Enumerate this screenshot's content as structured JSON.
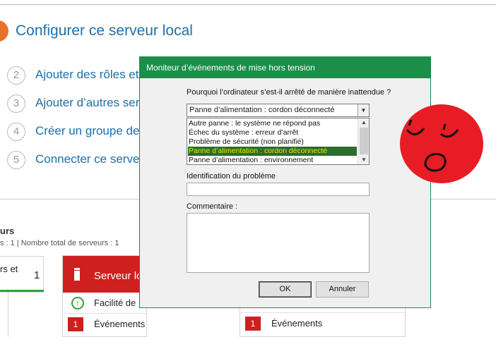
{
  "background_window": {
    "title": "Configurer ce serveur local",
    "steps": [
      {
        "num": "2",
        "label": "Ajouter des rôles et"
      },
      {
        "num": "3",
        "label": "Ajouter d’autres ser"
      },
      {
        "num": "4",
        "label": "Créer un groupe de"
      },
      {
        "num": "5",
        "label": "Connecter ce serveu"
      }
    ],
    "lower_title": "urs",
    "lower_stats": "s : 1   |   Nombre total de serveurs : 1",
    "left_tile": {
      "name": "rs et",
      "count": "1"
    },
    "server_tile": {
      "title": "Serveur lo",
      "rows": [
        {
          "label": "Facilité de"
        },
        {
          "badge": "1",
          "label": "Événements"
        }
      ]
    },
    "right_tile": {
      "badge": "1",
      "label": "Événements"
    }
  },
  "dialog": {
    "title": "Moniteur d’événements de mise hors tension",
    "question": "Pourquoi l’ordinateur s’est-il arrêté de manière inattendue ?",
    "selected_value": "Panne d’alimentation : cordon déconnecté",
    "options": [
      "Autre panne : le système ne répond pas",
      "Échec du système : erreur d’arrêt",
      "Problème de sécurité (non planifié)",
      "Panne d’alimentation : cordon déconnecté",
      "Panne d’alimentation : environnement"
    ],
    "selected_index": 3,
    "ident_label": "Identification du problème",
    "ident_value": "",
    "comment_label": "Commentaire :",
    "comment_value": "",
    "ok_label": "OK",
    "cancel_label": "Annuler"
  },
  "colors": {
    "accent_blue": "#1e6fa8",
    "dialog_green": "#1c8e4a",
    "alert_red": "#cf1f1f",
    "highlight_yellow": "#fbf22a"
  }
}
